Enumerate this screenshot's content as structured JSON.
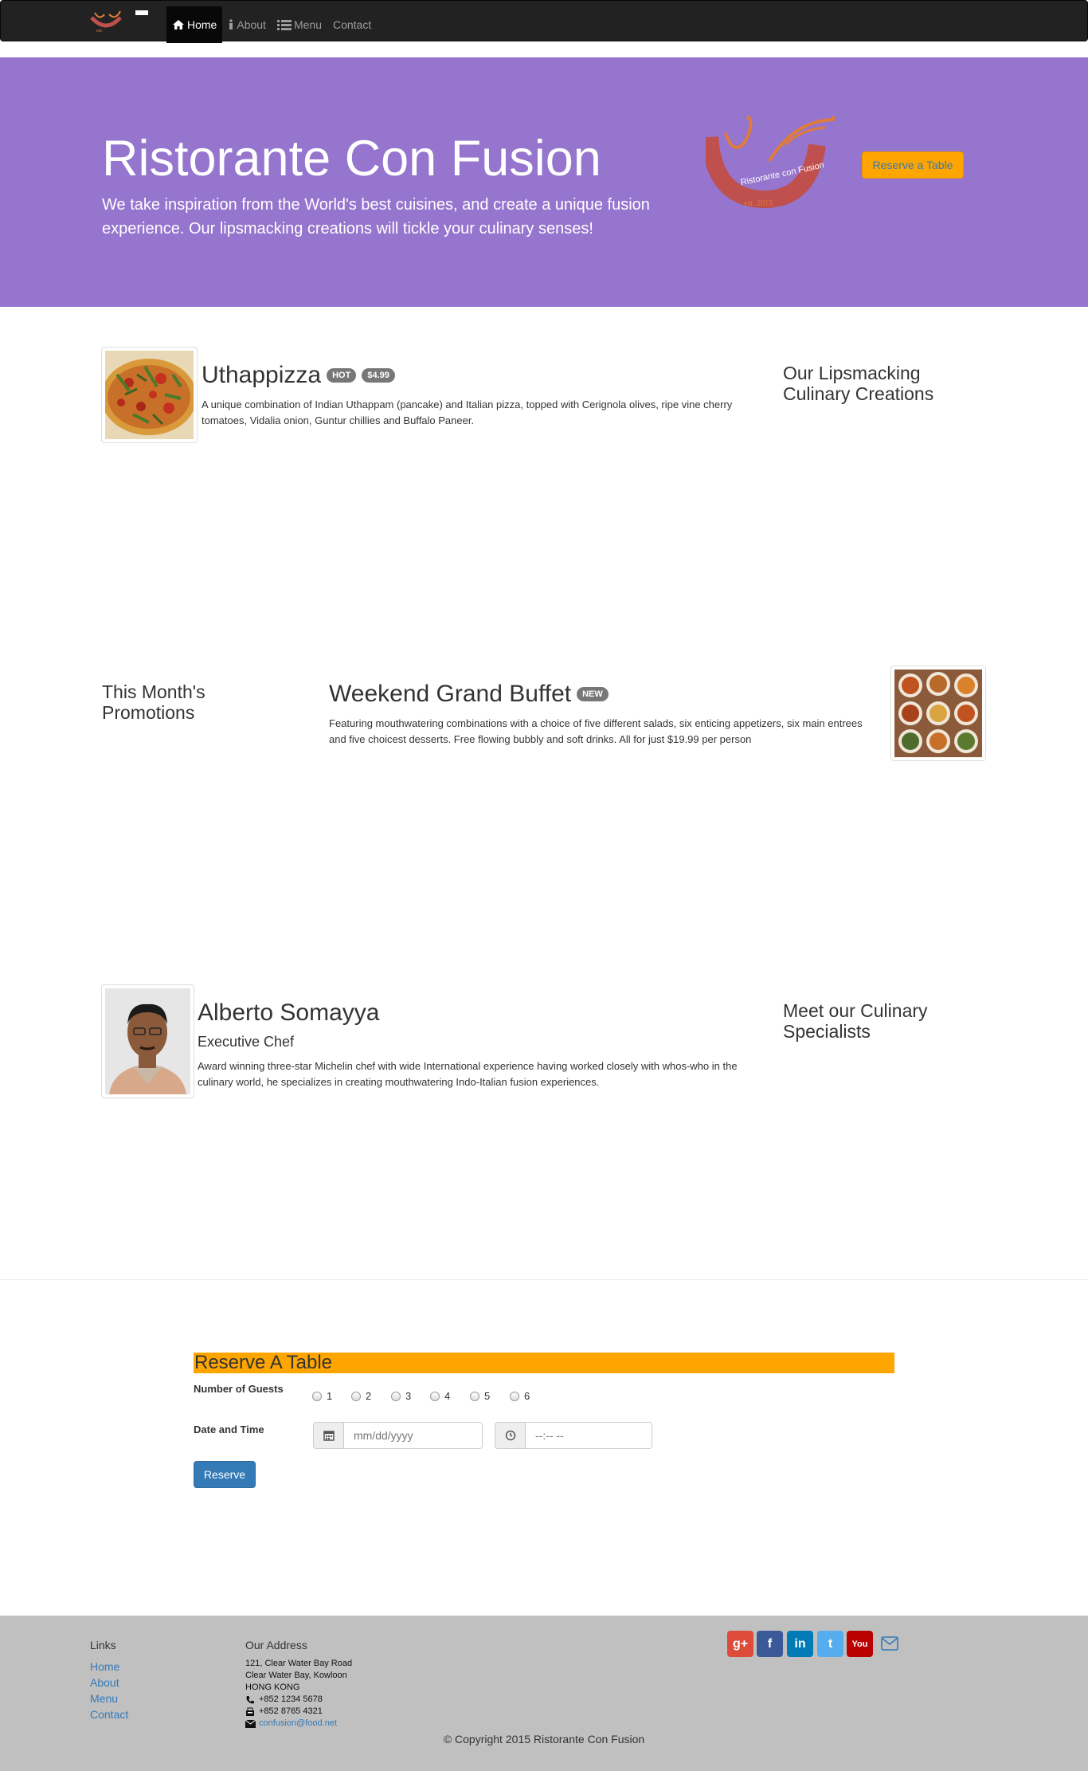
{
  "nav": {
    "items": [
      {
        "label": "Home",
        "icon": "home-icon"
      },
      {
        "label": "About",
        "icon": "info-icon"
      },
      {
        "label": "Menu",
        "icon": "list-icon"
      },
      {
        "label": "Contact",
        "icon": ""
      }
    ]
  },
  "hero": {
    "title": "Ristorante Con Fusion",
    "subtitle": "We take inspiration from the World's best cuisines, and create a unique fusion experience. Our lipsmacking creations will tickle your culinary senses!",
    "reserve_label": "Reserve a Table",
    "colors": {
      "background": "#9575cd",
      "button": "#ffa500"
    }
  },
  "dish": {
    "title": "Uthappizza",
    "badges": [
      "HOT",
      "$4.99"
    ],
    "description": "A unique combination of Indian Uthappam (pancake) and Italian pizza, topped with Cerignola olives, ripe vine cherry tomatoes, Vidalia onion, Guntur chillies and Buffalo Paneer.",
    "side_heading": "Our Lipsmacking Culinary Creations"
  },
  "promotion": {
    "side_heading": "This Month's Promotions",
    "title": "Weekend Grand Buffet",
    "badge": "NEW",
    "description": "Featuring mouthwatering combinations with a choice of five different salads, six enticing appetizers, six main entrees and five choicest desserts. Free flowing bubbly and soft drinks. All for just $19.99 per person"
  },
  "chef": {
    "name": "Alberto Somayya",
    "role": "Executive Chef",
    "description": "Award winning three-star Michelin chef with wide International experience having worked closely with whos-who in the culinary world, he specializes in creating mouthwatering Indo-Italian fusion experiences.",
    "side_heading": "Meet our Culinary Specialists"
  },
  "reservation": {
    "title": "Reserve A Table",
    "guests_label": "Number of Guests",
    "guest_options": [
      "1",
      "2",
      "3",
      "4",
      "5",
      "6"
    ],
    "datetime_label": "Date and Time",
    "date_placeholder": "mm/dd/yyyy",
    "time_placeholder": "--:-- --",
    "submit_label": "Reserve"
  },
  "footer": {
    "links_heading": "Links",
    "links": [
      "Home",
      "About",
      "Menu",
      "Contact"
    ],
    "address_heading": "Our Address",
    "address_lines": [
      "121, Clear Water Bay Road",
      "Clear Water Bay, Kowloon",
      "HONG KONG"
    ],
    "phone": "+852 1234 5678",
    "fax": "+852 8765 4321",
    "email": "confusion@food.net",
    "social": [
      {
        "label": "g+",
        "icon": "google-plus-icon",
        "color": "#dd4b39"
      },
      {
        "label": "f",
        "icon": "facebook-icon",
        "color": "#3b5998"
      },
      {
        "label": "in",
        "icon": "linkedin-icon",
        "color": "#007bb6"
      },
      {
        "label": "t",
        "icon": "twitter-icon",
        "color": "#55acee"
      },
      {
        "label": "You",
        "icon": "youtube-icon",
        "color": "#bb0000"
      }
    ],
    "copyright": "© Copyright 2015 Ristorante Con Fusion"
  }
}
